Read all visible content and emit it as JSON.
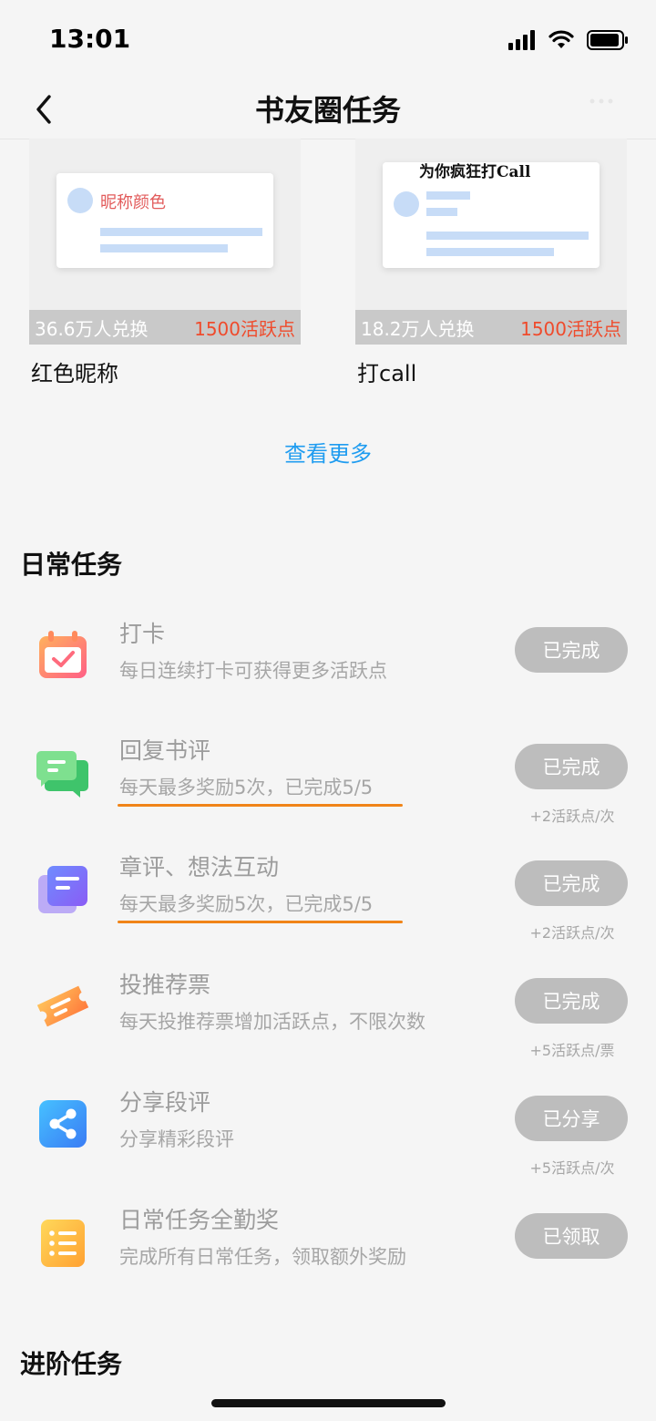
{
  "status": {
    "time": "13:01"
  },
  "nav": {
    "title": "书友圈任务"
  },
  "rewards": [
    {
      "preview_nick": "昵称颜色",
      "count": "36.6万人兑换",
      "price": "1500活跃点",
      "name": "红色昵称"
    },
    {
      "preview_banner": "为你疯狂打Call",
      "count": "18.2万人兑换",
      "price": "1500活跃点",
      "name": "打call"
    }
  ],
  "more_label": "查看更多",
  "daily": {
    "title": "日常任务",
    "tasks": [
      {
        "icon": "calendar-check-icon",
        "name": "打卡",
        "desc": "每日连续打卡可获得更多活跃点",
        "button": "已完成",
        "reward": ""
      },
      {
        "icon": "chat-bubbles-icon",
        "name": "回复书评",
        "desc": "每天最多奖励5次，已完成5/5",
        "button": "已完成",
        "reward": "+2活跃点/次"
      },
      {
        "icon": "document-icon",
        "name": "章评、想法互动",
        "desc": "每天最多奖励5次，已完成5/5",
        "button": "已完成",
        "reward": "+2活跃点/次"
      },
      {
        "icon": "ticket-icon",
        "name": "投推荐票",
        "desc": "每天投推荐票增加活跃点，不限次数",
        "button": "已完成",
        "reward": "+5活跃点/票"
      },
      {
        "icon": "share-icon",
        "name": "分享段评",
        "desc": "分享精彩段评",
        "button": "已分享",
        "reward": "+5活跃点/次"
      },
      {
        "icon": "list-icon",
        "name": "日常任务全勤奖",
        "desc": "完成所有日常任务，领取额外奖励",
        "button": "已领取",
        "reward": ""
      }
    ]
  },
  "advanced": {
    "title": "进阶任务"
  },
  "colors": {
    "accent_link": "#1f9cf0",
    "price": "#ef4b2c",
    "underline": "#f08418",
    "button_done": "#bdbdbd"
  }
}
